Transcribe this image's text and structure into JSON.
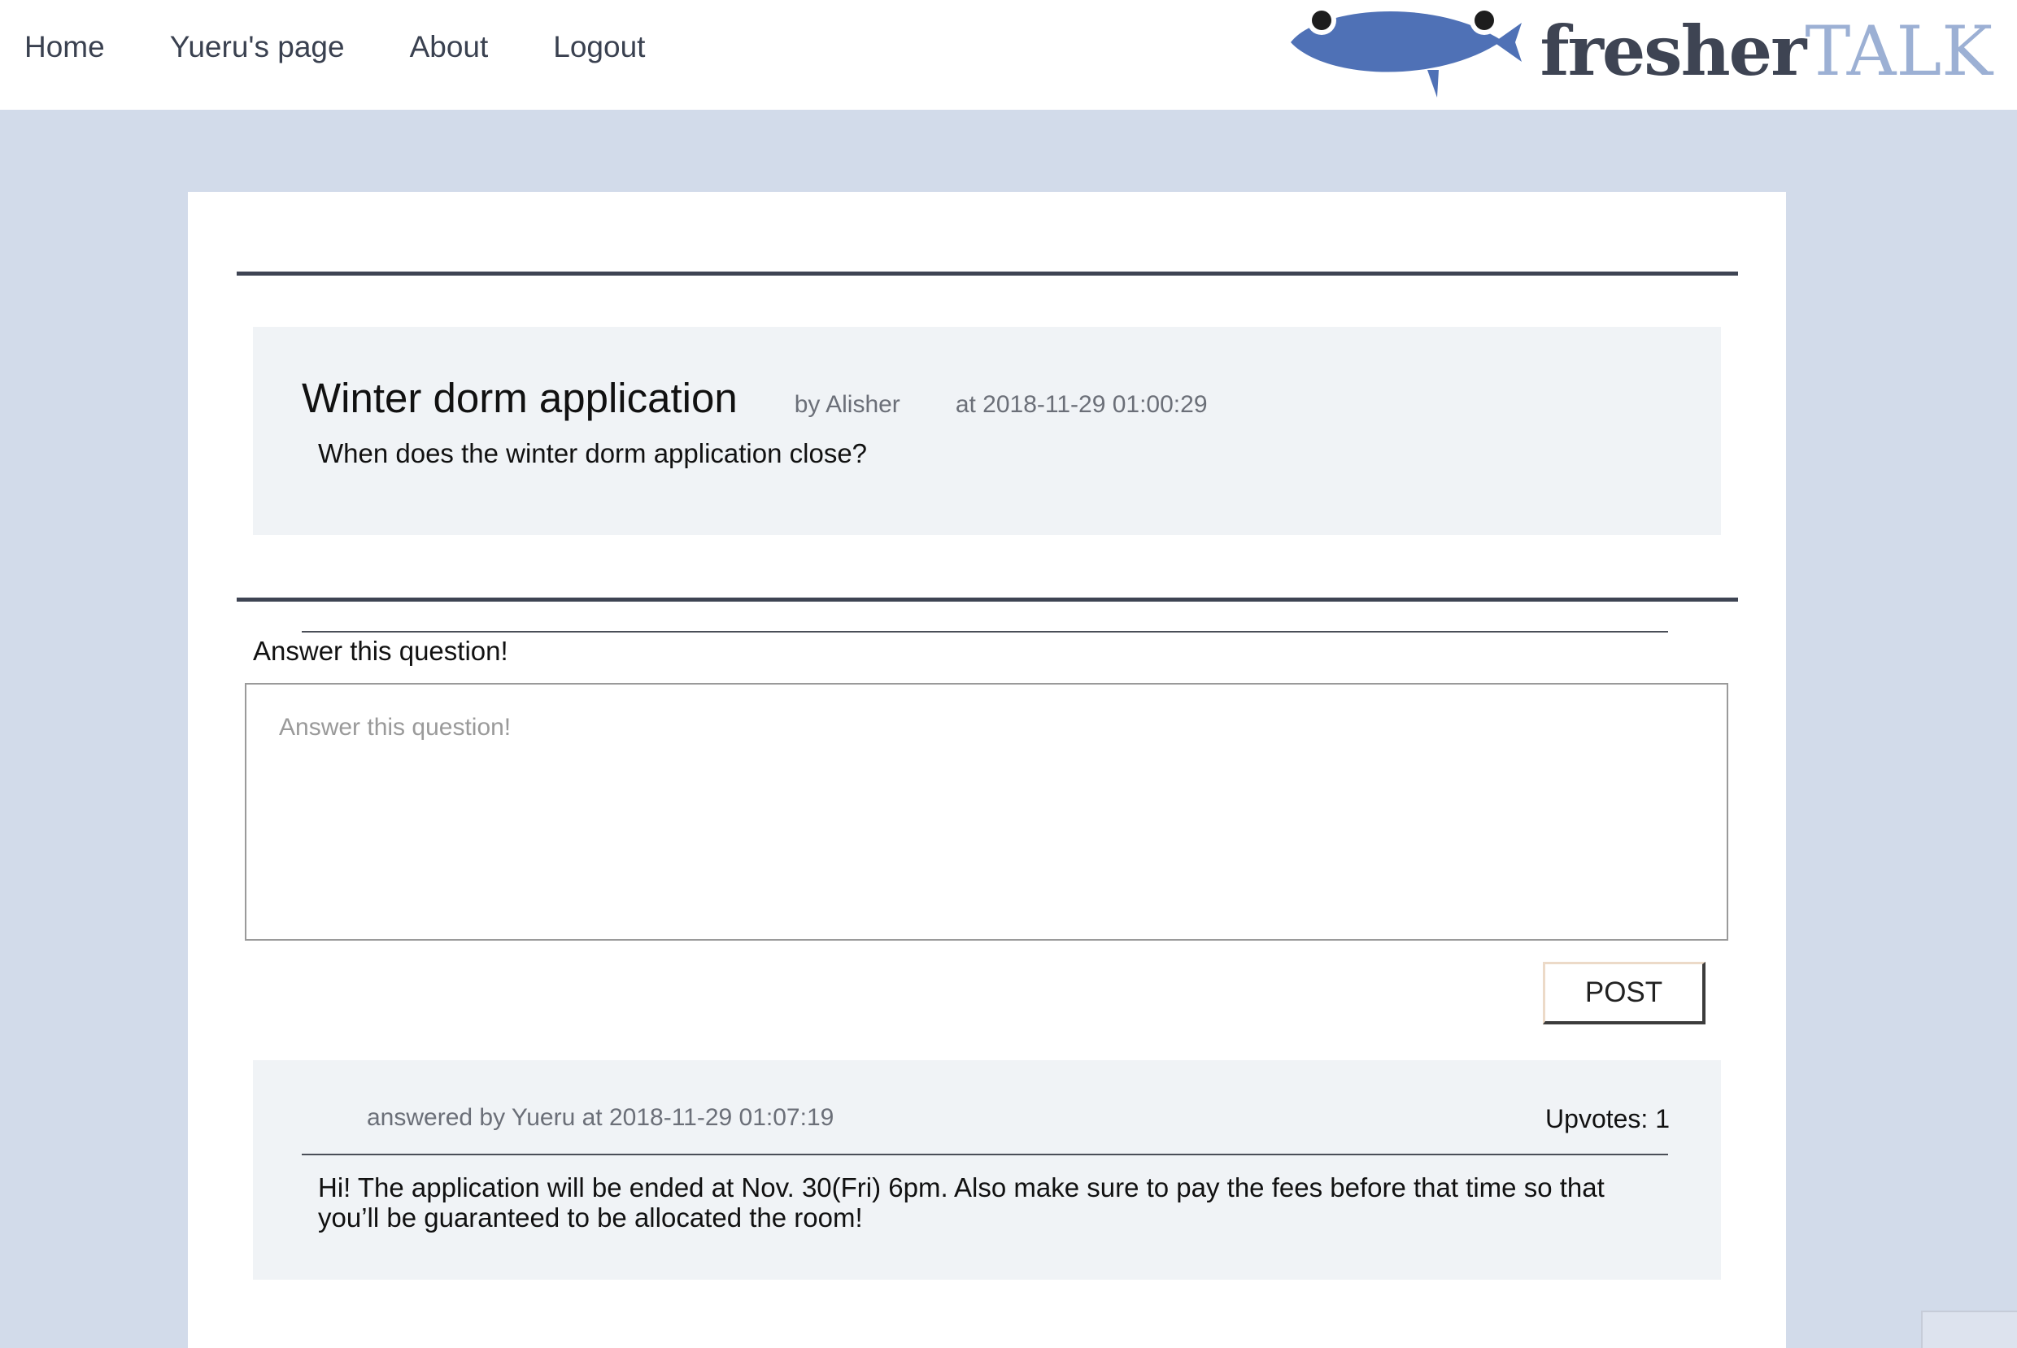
{
  "nav": {
    "links": [
      "Home",
      "Yueru's page",
      "About",
      "Logout"
    ]
  },
  "brand": {
    "part1": "fresher",
    "part2": "TALK",
    "icon": "fish-logo-icon"
  },
  "question": {
    "title": "Winter dorm application",
    "author": "by Alisher",
    "timestamp": "at 2018-11-29 01:00:29",
    "body": "When does the winter dorm application close?"
  },
  "answer_form": {
    "label": "Answer this question!",
    "placeholder": "Answer this question!",
    "submit_label": "POST"
  },
  "answers": [
    {
      "meta": "answered by Yueru at 2018-11-29 01:07:19",
      "upvotes": "Upvotes: 1",
      "body": "Hi! The application will be ended at Nov. 30(Fri) 6pm. Also make sure to pay the fees before that time so that you’ll be guaranteed to be allocated the room!"
    }
  ],
  "colors": {
    "page_bg": "#d2dbea",
    "nav_bg": "#ffffff",
    "card_bg": "#ffffff",
    "post_bg": "#f0f3f6",
    "rule": "#3e4453",
    "brand_dark": "#3e4453",
    "brand_light": "#9cb0d4",
    "fish": "#4f71b6"
  }
}
